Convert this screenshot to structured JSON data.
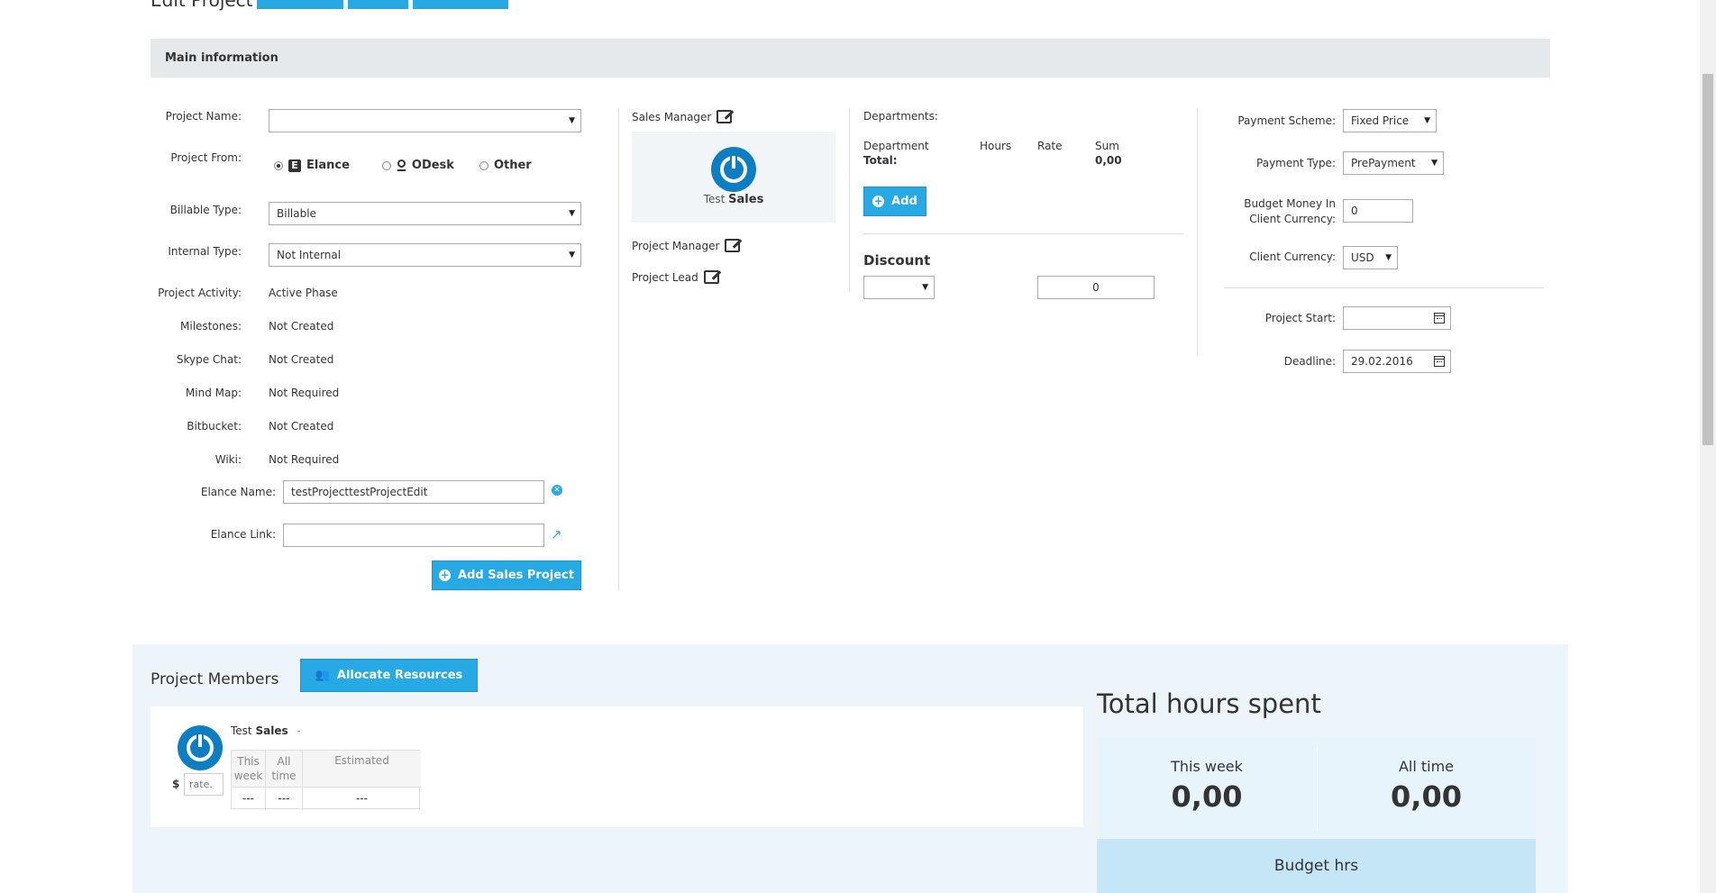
{
  "header": {
    "title": "Edit Project",
    "buttons": [
      "",
      "",
      ""
    ]
  },
  "main_info": {
    "title": "Main information",
    "fields": {
      "project_name_label": "Project Name:",
      "project_name_value": "",
      "project_from_label": "Project From:",
      "project_from_options": [
        "Elance",
        "ODesk",
        "Other"
      ],
      "project_from_selected": "Elance",
      "billable_type_label": "Billable Type:",
      "billable_type_value": "Billable",
      "internal_type_label": "Internal Type:",
      "internal_type_value": "Not Internal",
      "project_activity_label": "Project Activity:",
      "project_activity_value": "Active Phase",
      "milestones_label": "Milestones:",
      "milestones_value": "Not Created",
      "skype_chat_label": "Skype Chat:",
      "skype_chat_value": "Not Created",
      "mind_map_label": "Mind Map:",
      "mind_map_value": "Not Required",
      "bitbucket_label": "Bitbucket:",
      "bitbucket_value": "Not Created",
      "wiki_label": "Wiki:",
      "wiki_value": "Not Required",
      "elance_name_label": "Elance Name:",
      "elance_name_value": "testProjecttestProjectEdit",
      "elance_link_label": "Elance Link:",
      "elance_link_value": "",
      "add_sales_project_label": "Add Sales Project"
    },
    "people": {
      "sales_manager_label": "Sales Manager",
      "sales_manager_first": "Test",
      "sales_manager_last": "Sales",
      "project_manager_label": "Project Manager",
      "project_lead_label": "Project Lead"
    },
    "departments": {
      "label": "Departments:",
      "col_department": "Department",
      "col_hours": "Hours",
      "col_rate": "Rate",
      "col_sum": "Sum",
      "total_label": "Total:",
      "total_sum": "0,00",
      "add_label": "Add",
      "discount_label": "Discount",
      "discount_select": "",
      "discount_value": "0"
    },
    "payment": {
      "payment_scheme_label": "Payment Scheme:",
      "payment_scheme_value": "Fixed Price",
      "payment_type_label": "Payment Type:",
      "payment_type_value": "PrePayment",
      "budget_label_line1": "Budget Money In",
      "budget_label_line2": "Client Currency:",
      "budget_value": "0",
      "client_currency_label": "Client Currency:",
      "client_currency_value": "USD",
      "project_start_label": "Project Start:",
      "project_start_value": "",
      "deadline_label": "Deadline:",
      "deadline_value": "29.02.2016"
    }
  },
  "members": {
    "title": "Project Members",
    "allocate_label": "Allocate Resources",
    "member": {
      "first": "Test",
      "last": "Sales",
      "dash": "-",
      "currency": "$",
      "rate_placeholder": "rate.",
      "col_this_week": [
        "This",
        "week"
      ],
      "col_all_time": [
        "All",
        "time"
      ],
      "col_estimated": "Estimated",
      "val_this_week": "---",
      "val_all_time": "---",
      "val_estimated": "---"
    }
  },
  "hours": {
    "title": "Total hours spent",
    "this_week_label": "This week",
    "this_week_value": "0,00",
    "all_time_label": "All time",
    "all_time_value": "0,00",
    "budget_label": "Budget hrs"
  },
  "colors": {
    "accent": "#27a9e3",
    "header_bg": "#e6e9ec",
    "panel_bg": "#eef5fa",
    "stat_bg": "#e7f4fb",
    "budget_bg": "#c5e6f7"
  }
}
